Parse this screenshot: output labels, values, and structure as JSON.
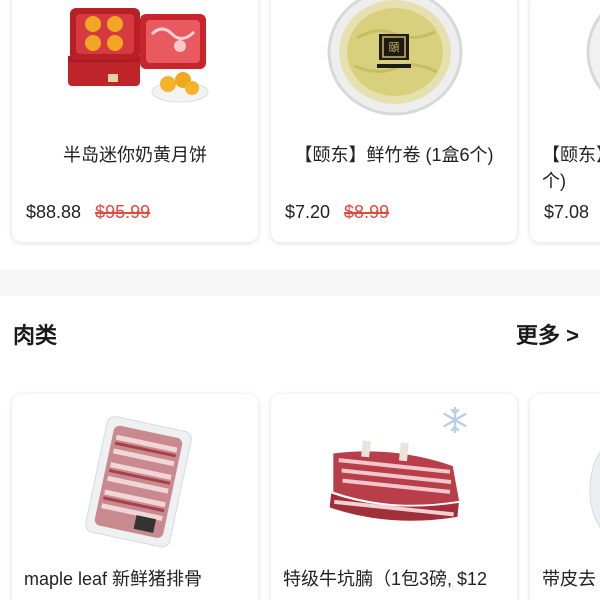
{
  "top_products": [
    {
      "name": "半岛迷你奶黄月饼",
      "price": "$88.88",
      "old_price": "$95.99",
      "image": "mooncake-gift-box"
    },
    {
      "name": "【颐东】鲜竹卷 (1盒6个)",
      "price": "$7.20",
      "old_price": "$8.99",
      "image": "bamboo-roll-container"
    },
    {
      "name": "【颐东】\n个)",
      "price": "$7.08",
      "old_price": "",
      "image": "container-partial"
    }
  ],
  "meat_section": {
    "title": "肉类",
    "more_label": "更多 >",
    "products": [
      {
        "name": "maple leaf 新鲜猪排骨",
        "image": "pork-ribs-pack",
        "frozen": false
      },
      {
        "name": "特级牛坑腩（1包3磅, $12",
        "image": "beef-short-ribs",
        "frozen": true
      },
      {
        "name": "带皮去",
        "image": "meat-partial",
        "frozen": false
      }
    ]
  },
  "colors": {
    "old_price": "#e04a3f",
    "text": "#222222",
    "background": "#f7f7f7",
    "card": "#ffffff",
    "snowflake": "#b9cfe6"
  }
}
